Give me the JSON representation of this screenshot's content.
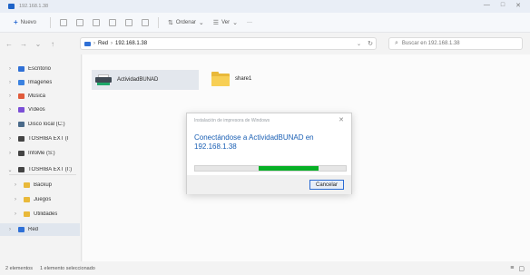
{
  "window": {
    "title": "192.168.1.38",
    "minimize": "—",
    "maximize": "□",
    "close": "✕"
  },
  "toolbar": {
    "new_label": "Nuevo",
    "sort_label": "Ordenar",
    "view_label": "Ver",
    "more_label": "···"
  },
  "nav": {
    "back": "←",
    "forward": "→",
    "up": "↑",
    "recent": "⌄"
  },
  "address": {
    "segments": [
      "Red",
      "192.168.1.38"
    ],
    "separator": "›",
    "chevron": "⌄",
    "refresh": "↻"
  },
  "search": {
    "placeholder": "Buscar en 192.168.1.38"
  },
  "sidebar": {
    "items": [
      {
        "label": "Escritorio",
        "icon": "desktop-icon",
        "color": "#2f70d6"
      },
      {
        "label": "Imágenes",
        "icon": "pictures-icon",
        "color": "#3b82e0"
      },
      {
        "label": "Música",
        "icon": "music-icon",
        "color": "#e05b3b"
      },
      {
        "label": "Vídeos",
        "icon": "videos-icon",
        "color": "#7b4fd6"
      },
      {
        "label": "Disco local (C:)",
        "icon": "drive-icon",
        "color": "#4a6a8a"
      },
      {
        "label": "TOSHIBA EXT (I",
        "icon": "usb-drive-icon",
        "color": "#444444"
      },
      {
        "label": "InfoMe (S:)",
        "icon": "usb-drive-icon",
        "color": "#444444"
      },
      {
        "label": "TOSHIBA EXT (I:)",
        "icon": "usb-drive-icon",
        "color": "#444444"
      },
      {
        "label": "Backup",
        "icon": "folder-icon",
        "color": "#e9b93a"
      },
      {
        "label": "Juegos",
        "icon": "folder-icon",
        "color": "#e9b93a"
      },
      {
        "label": "Utilidades",
        "icon": "folder-icon",
        "color": "#e9b93a"
      },
      {
        "label": "Red",
        "icon": "network-icon",
        "color": "#2f70d6"
      }
    ]
  },
  "content": {
    "items": [
      {
        "label": "ActividadBUNAD",
        "type": "printer"
      },
      {
        "label": "share1",
        "type": "folder"
      }
    ]
  },
  "status": {
    "count": "2 elementos",
    "selected": "1 elemento seleccionado"
  },
  "dialog": {
    "title": "Instalación de impresora de Windows",
    "message": "Conectándose a ActividadBUNAD en 192.168.1.38",
    "cancel_label": "Cancelar",
    "close": "✕",
    "progress_indicator": {
      "start_fraction": 0.42,
      "end_fraction": 0.82
    },
    "accent_color": "#06b025"
  },
  "colors": {
    "accent": "#1a5fb4",
    "progress": "#06b025",
    "folder": "#f7cf55"
  }
}
